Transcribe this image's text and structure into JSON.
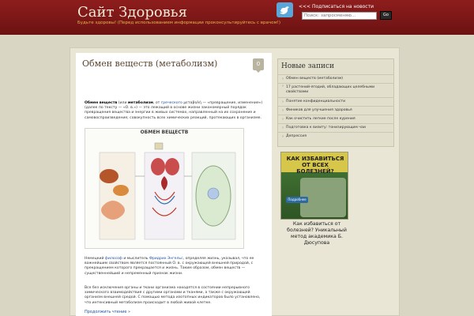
{
  "header": {
    "title": "Сайт Здоровья",
    "description": "Будьте здоровы! (Перед использованием информации проконсультируйтесь с врачом!)",
    "rss_label": "<<< Подписаться на новости",
    "search_placeholder": "Поиск: запросменяю...",
    "search_button": "Go"
  },
  "post": {
    "title": "Обмен веществ (метаболизм)",
    "comments": "0",
    "p1_bold": "Обмен веществ",
    "p1_a": "(или",
    "p1_bold2": "метаболизм",
    "p1_b": ", от",
    "p1_link": "греческого",
    "p1_rest": "μεταβολή — «превращение, изменение») (далее по тексту — «О. в.») — это лежащий в основе жизни закономерный порядок превращения вещества и энергии в живых системах, направленный на их сохранение и самовоспроизведение; совокупность всех химических реакций, протекающих в организме.",
    "p2_a": "Немецкий",
    "p2_link1": "философ",
    "p2_b": "и мыслитель",
    "p2_link2": "Фридрих Энгельс",
    "p2_rest": ", определяя жизнь, указывал, что ее важнейшим свойством является постоянный О. в. с окружающей внешней природой, с прекращением которого прекращается и жизнь. Таким образом, обмен веществ — существеннейший и непременный признак жизни.",
    "p3": "Все без исключения органы и ткани организма находятся в состоянии непрерывного химического взаимодействия с другими органами и тканями, а также с окружающей организм внешней средой. С помощью метода изотопных индикаторов было установлено, что интенсивный метаболизм происходит в любой живой клетке.",
    "read_more": "Продолжить чтение »",
    "diagram_title": "ОБМЕН ВЕЩЕСТВ"
  },
  "sidebar": {
    "heading": "Новые записи",
    "items": [
      "Обмен веществ (метаболизм)",
      "17 растений-ягодий, обладающих целебными свойствами",
      "Понятие конфиденциальности",
      "Фиников для улучшения здоровья",
      "Как очистить легкие после курения",
      "Подготовка к визиту: тонизирующим чаи",
      "Депрессия"
    ],
    "ad_title": "КАК ИЗБАВИТЬСЯ ОТ ВСЕХ БОЛЕЗНЕЙ?",
    "ad_button": "Подробнее",
    "ad_text": "Как избавиться от болезней? Уникальный метод академика Б. Дюсупова"
  }
}
